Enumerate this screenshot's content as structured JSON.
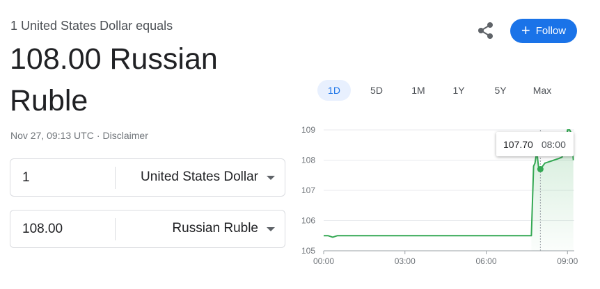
{
  "header": {
    "equals_text": "1 United States Dollar equals",
    "result_line1": "108.00 Russian",
    "result_line2": "Ruble",
    "timestamp": "Nov 27, 09:13 UTC",
    "separator": "·",
    "disclaimer": "Disclaimer"
  },
  "actions": {
    "share_icon": "share-icon",
    "follow_label": "Follow",
    "follow_plus": "+"
  },
  "converter": {
    "from": {
      "amount": "1",
      "currency": "United States Dollar"
    },
    "to": {
      "amount": "108.00",
      "currency": "Russian Ruble"
    }
  },
  "ranges": [
    "1D",
    "5D",
    "1M",
    "1Y",
    "5Y",
    "Max"
  ],
  "active_range": "1D",
  "tooltip": {
    "price": "107.70",
    "time": "08:00"
  },
  "colors": {
    "accent": "#1a73e8",
    "line": "#34a853",
    "text": "#202124"
  },
  "chart_data": {
    "type": "line",
    "series": [
      {
        "x": [
          "00:00",
          "00:10",
          "00:20",
          "00:30",
          "00:40",
          "01:00",
          "02:00",
          "03:00",
          "04:00",
          "05:00",
          "06:00",
          "07:00",
          "07:40",
          "07:45",
          "07:48",
          "07:52",
          "07:56",
          "08:00",
          "08:10",
          "08:20",
          "08:30",
          "08:40",
          "08:48",
          "08:52",
          "08:56",
          "09:00",
          "09:05",
          "09:08",
          "09:13"
        ],
        "values": [
          105.5,
          105.5,
          105.45,
          105.5,
          105.5,
          105.5,
          105.5,
          105.5,
          105.5,
          105.5,
          105.5,
          105.5,
          105.5,
          107.8,
          107.9,
          108.3,
          107.75,
          107.7,
          107.9,
          107.95,
          108.0,
          108.05,
          108.1,
          108.3,
          108.4,
          109.0,
          109.0,
          108.9,
          108.0
        ]
      }
    ],
    "xlabels": [
      "00:00",
      "03:00",
      "06:00",
      "09:00"
    ],
    "yticks": [
      105,
      106,
      107,
      108,
      109
    ],
    "ylim": [
      105,
      109
    ],
    "x_range_minutes": [
      0,
      555
    ],
    "grid": true,
    "hover_point": {
      "x": "08:00",
      "y": 107.7
    },
    "area_fill": true
  }
}
